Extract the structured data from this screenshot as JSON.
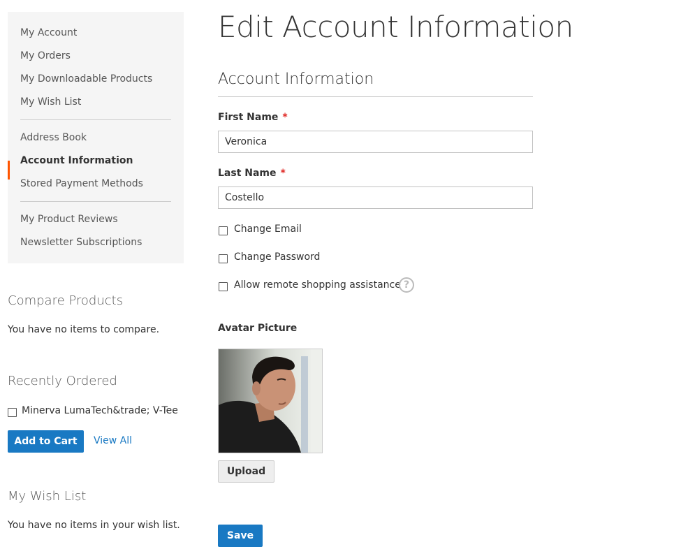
{
  "sidebar": {
    "items": [
      {
        "label": "My Account"
      },
      {
        "label": "My Orders"
      },
      {
        "label": "My Downloadable Products"
      },
      {
        "label": "My Wish List"
      },
      {
        "label": "Address Book"
      },
      {
        "label": "Account Information"
      },
      {
        "label": "Stored Payment Methods"
      },
      {
        "label": "My Product Reviews"
      },
      {
        "label": "Newsletter Subscriptions"
      }
    ]
  },
  "compare": {
    "title": "Compare Products",
    "empty_text": "You have no items to compare."
  },
  "recently_ordered": {
    "title": "Recently Ordered",
    "item": "Minerva LumaTech&trade; V-Tee",
    "add_to_cart": "Add to Cart",
    "view_all": "View All"
  },
  "wishlist": {
    "title": "My Wish List",
    "empty_text": "You have no items in your wish list."
  },
  "main": {
    "page_title": "Edit Account Information",
    "section_title": "Account Information",
    "first_name_label": "First Name",
    "first_name_value": "Veronica",
    "last_name_label": "Last Name",
    "last_name_value": "Costello",
    "required_mark": "*",
    "change_email": "Change Email",
    "change_password": "Change Password",
    "remote_assistance": "Allow remote shopping assistance",
    "help_glyph": "?",
    "avatar_label": "Avatar Picture",
    "upload_label": "Upload",
    "save_label": "Save"
  },
  "colors": {
    "accent": "#1979c3",
    "active_marker": "#ff5501",
    "required": "#e02b27"
  },
  "icons": {
    "help": "question-circle-icon"
  }
}
